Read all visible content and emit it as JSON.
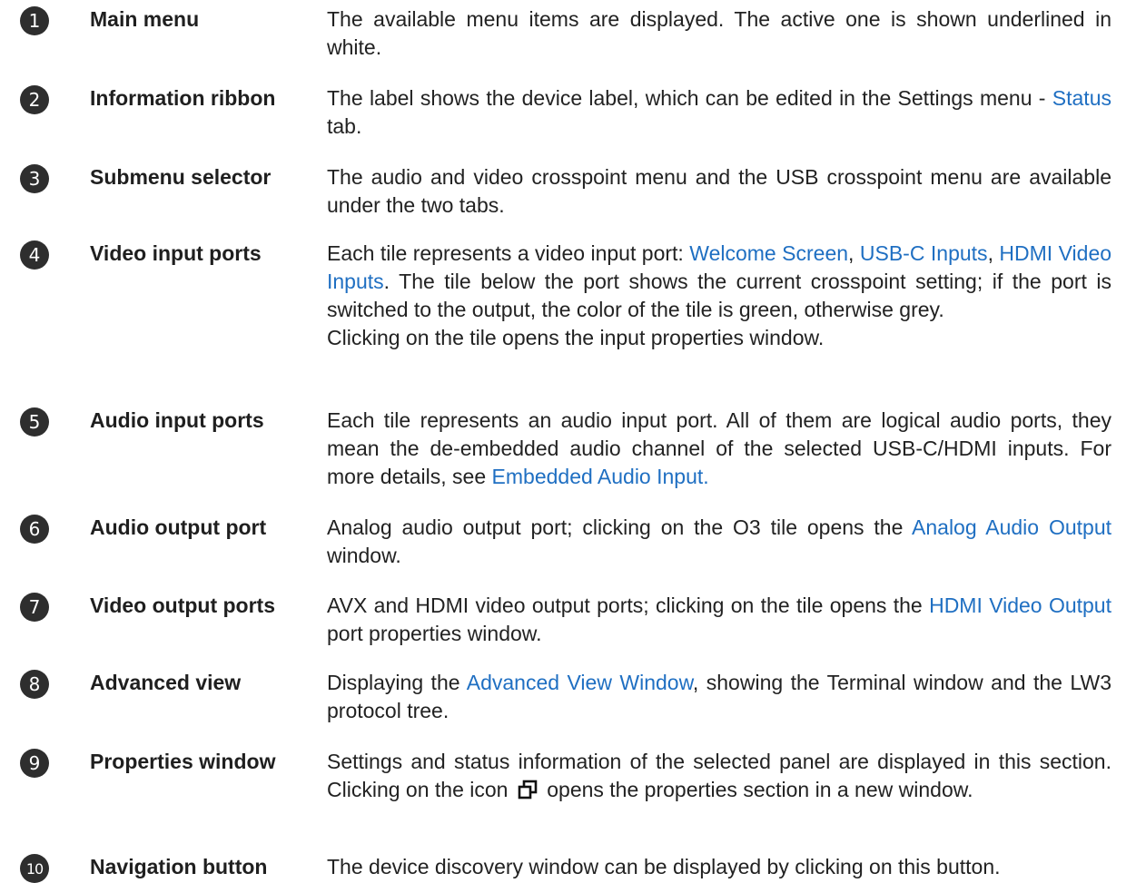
{
  "items": [
    {
      "number": "1",
      "term": "Main menu",
      "desc": [
        "The available menu items are displayed. The active one is shown underlined in white."
      ]
    },
    {
      "number": "2",
      "term": "Information ribbon",
      "desc": [
        "The label shows the device label, which can be edited in the Settings menu - ",
        "Status",
        " tab."
      ]
    },
    {
      "number": "3",
      "term": "Submenu selector",
      "desc": [
        "The audio and video crosspoint menu and the USB crosspoint menu are available under the two tabs."
      ]
    },
    {
      "number": "4",
      "term": "Video input ports",
      "desc": [
        "Each tile represents a video input port: ",
        "Welcome Screen",
        ", ",
        "USB-C Inputs",
        ", ",
        "HDMI Video Inputs",
        ". The tile below the port shows the current crosspoint setting; if the port is switched to the output, the color of the tile is green, otherwise grey."
      ],
      "desc2": "Clicking on the tile opens the input properties window."
    },
    {
      "number": "5",
      "term": "Audio input ports",
      "desc": [
        "Each tile represents an audio input port. All of them are logical audio ports, they mean the de-embedded audio channel of the selected USB-C/HDMI inputs. For more details, see ",
        "Embedded Audio Input."
      ]
    },
    {
      "number": "6",
      "term": "Audio output port",
      "desc": [
        "Analog audio output port; clicking on the O3 tile opens the ",
        "Analog Audio Output",
        " window."
      ]
    },
    {
      "number": "7",
      "term": "Video output ports",
      "desc": [
        "AVX and HDMI video output ports; clicking on the tile opens the ",
        "HDMI Video Output",
        " port properties window."
      ]
    },
    {
      "number": "8",
      "term": "Advanced view",
      "desc": [
        "Displaying the ",
        "Advanced View Window",
        ", showing the Terminal window and the LW3 protocol tree."
      ]
    },
    {
      "number": "9",
      "term": "Properties window",
      "desc": [
        "Settings and status information of the selected panel are displayed in this section. Clicking on the icon",
        "opens the properties section in a new window."
      ]
    },
    {
      "number": "10",
      "term": "Navigation button",
      "desc": [
        "The device discovery window can be displayed by clicking on this button."
      ]
    }
  ],
  "colors": {
    "link": "#1f6fc2",
    "badge": "#2e2e2e",
    "text": "#222222"
  },
  "icons": {
    "new_window": "open-in-new-window-icon"
  }
}
